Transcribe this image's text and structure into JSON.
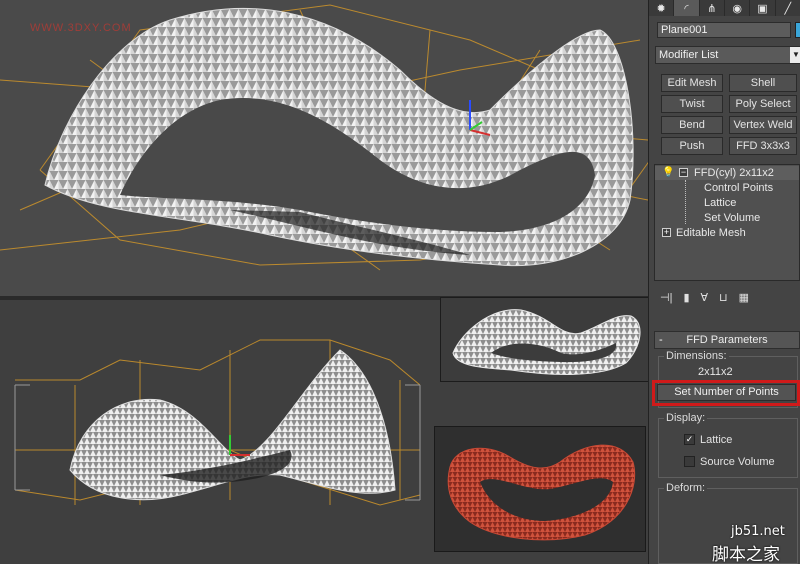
{
  "watermark": "WWW.3DXY.COM",
  "tabs": [
    {
      "icon": "sun-icon",
      "glyph": "✹"
    },
    {
      "icon": "modify-icon",
      "glyph": "◜"
    },
    {
      "icon": "hierarchy-icon",
      "glyph": "⋔"
    },
    {
      "icon": "motion-icon",
      "glyph": "◉"
    },
    {
      "icon": "display-icon",
      "glyph": "▣"
    },
    {
      "icon": "utilities-icon",
      "glyph": "╱"
    }
  ],
  "object_name": "Plane001",
  "object_color": "#3aa6d9",
  "modifier_list": "Modifier List",
  "modifier_buttons": {
    "edit_mesh": "Edit Mesh",
    "shell": "Shell",
    "twist": "Twist",
    "poly_select": "Poly Select",
    "bend": "Bend",
    "vertex_weld": "Vertex Weld",
    "push": "Push",
    "ffd_3x3x3": "FFD 3x3x3"
  },
  "stack": {
    "modifier": "FFD(cyl) 2x11x2",
    "sub_control_points": "Control Points",
    "sub_lattice": "Lattice",
    "sub_set_volume": "Set Volume",
    "base": "Editable Mesh"
  },
  "ffd_params": {
    "title": "FFD Parameters",
    "dimensions_label": "Dimensions:",
    "dimensions_value": "2x11x2",
    "set_points_button": "Set Number of Points",
    "display_label": "Display:",
    "lattice_label": "Lattice",
    "lattice_checked": true,
    "source_volume_label": "Source Volume",
    "source_volume_checked": false,
    "deform_label": "Deform:"
  },
  "site_mark": "jb51.net",
  "site_mark_cn": "脚本之家",
  "colors": {
    "lattice": "#c8912b",
    "highlight": "#d01a1a",
    "red_model": "#b53a2a"
  }
}
